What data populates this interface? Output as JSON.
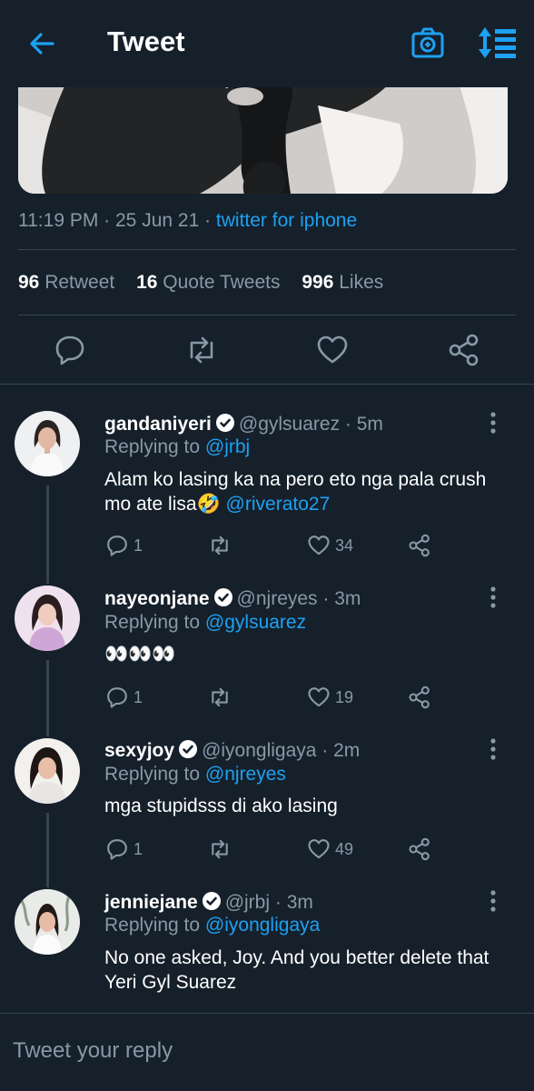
{
  "header": {
    "title": "Tweet",
    "accent": "#1da1f2"
  },
  "tweet": {
    "time": "11:19 PM",
    "date": "25 Jun 21",
    "source": "twitter for iphone",
    "retweets": "96",
    "retweets_label": "Retweet",
    "quotes": "16",
    "quotes_label": "Quote Tweets",
    "likes": "996",
    "likes_label": "Likes"
  },
  "replies": [
    {
      "name": "gandaniyeri",
      "handle": "@gylsuarez",
      "time": "5m",
      "replying_prefix": "Replying to",
      "replying_to": "@jrbj",
      "text": "Alam ko lasing ka na pero eto nga pala crush mo ate lisa🤣",
      "mention": "@riverato27",
      "reply_count": "1",
      "like_count": "34"
    },
    {
      "name": "nayeonjane",
      "handle": "@njreyes",
      "time": "3m",
      "replying_prefix": "Replying to",
      "replying_to": "@gylsuarez",
      "text": "👀👀👀",
      "reply_count": "1",
      "like_count": "19"
    },
    {
      "name": "sexyjoy",
      "handle": "@iyongligaya",
      "time": "2m",
      "replying_prefix": "Replying to",
      "replying_to": "@njreyes",
      "text": "mga stupidsss di ako lasing",
      "reply_count": "1",
      "like_count": "49"
    },
    {
      "name": "jenniejane",
      "handle": "@jrbj",
      "time": "3m",
      "replying_prefix": "Replying to",
      "replying_to": "@iyongligaya",
      "text": "No one asked, Joy. And you better delete that Yeri Gyl Suarez"
    }
  ],
  "composer": {
    "placeholder": "Tweet your reply"
  },
  "icons": [
    "back-arrow-icon",
    "camera-icon",
    "sort-icon",
    "reply-icon",
    "retweet-icon",
    "like-icon",
    "share-icon",
    "verified-icon",
    "more-icon"
  ]
}
